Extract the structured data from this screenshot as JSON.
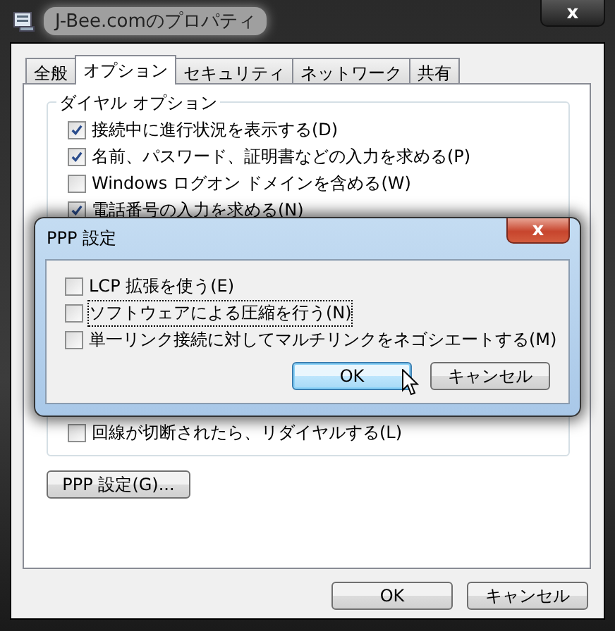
{
  "window": {
    "title": "J-Bee.comのプロパティ",
    "close": "x"
  },
  "tabs": [
    {
      "label": "全般",
      "selected": false
    },
    {
      "label": "オプション",
      "selected": true
    },
    {
      "label": "セキュリティ",
      "selected": false
    },
    {
      "label": "ネットワーク",
      "selected": false
    },
    {
      "label": "共有",
      "selected": false
    }
  ],
  "dial_options": {
    "title": "ダイヤル オプション",
    "items": [
      {
        "label": "接続中に進行状況を表示する(D)",
        "checked": true
      },
      {
        "label": "名前、パスワード、証明書などの入力を求める(P)",
        "checked": true
      },
      {
        "label": "Windows ログオン ドメインを含める(W)",
        "checked": false
      },
      {
        "label": "電話番号の入力を求める(N)",
        "checked": true
      }
    ],
    "after": [
      {
        "label": "回線が切断されたら、リダイヤルする(L)",
        "checked": false
      }
    ]
  },
  "ppp_button": "PPP 設定(G)...",
  "buttons": [
    "OK",
    "キャンセル"
  ],
  "dialog": {
    "title": "PPP 設定",
    "close": "x",
    "items": [
      {
        "label": "LCP 拡張を使う(E)",
        "checked": false,
        "focused": false
      },
      {
        "label": "ソフトウェアによる圧縮を行う(N)",
        "checked": false,
        "focused": true
      },
      {
        "label": "単一リンク接続に対してマルチリンクをネゴシエートする(M)",
        "checked": false,
        "focused": false
      }
    ],
    "buttons": [
      {
        "label": "OK",
        "default": true
      },
      {
        "label": "キャンセル",
        "default": false
      }
    ]
  }
}
